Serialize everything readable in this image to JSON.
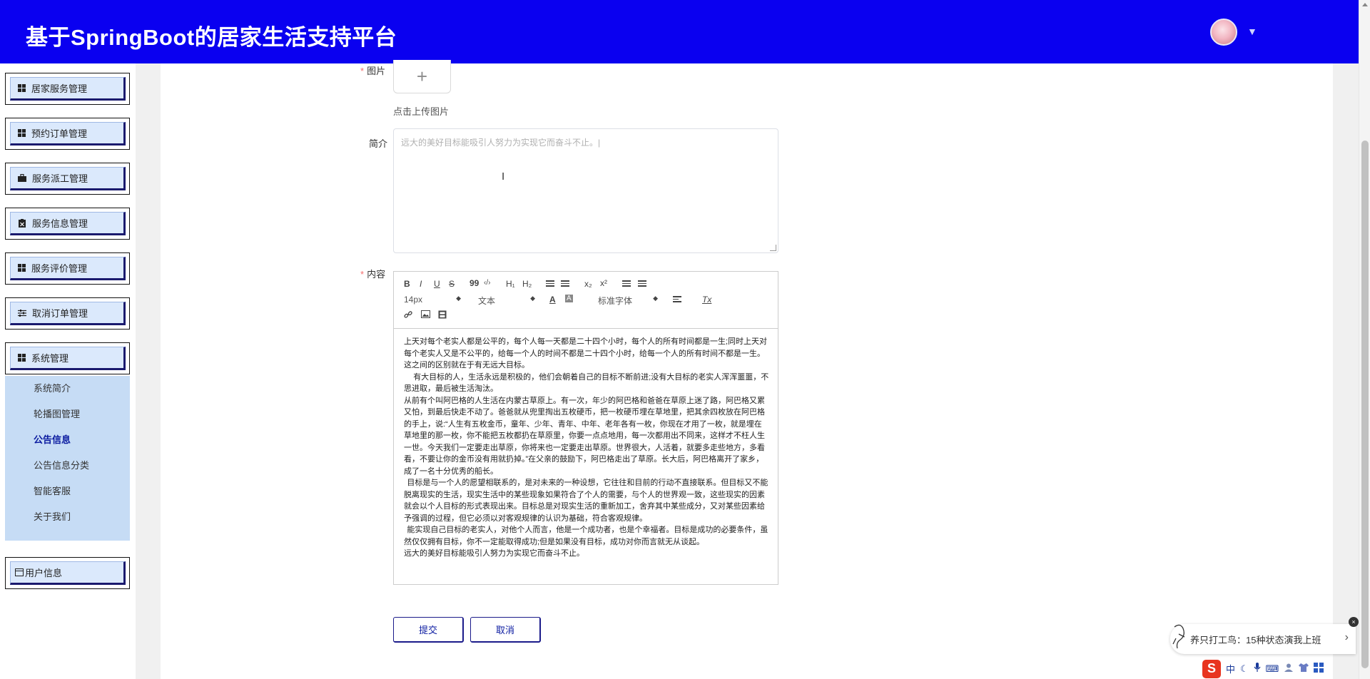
{
  "header": {
    "title": "基于SpringBoot的居家生活支持平台",
    "caret": "▼"
  },
  "sidebar": {
    "items": [
      {
        "label": "居家服务管理",
        "icon": "grid-icon"
      },
      {
        "label": "预约订单管理",
        "icon": "grid-icon"
      },
      {
        "label": "服务派工管理",
        "icon": "briefcase-icon"
      },
      {
        "label": "服务信息管理",
        "icon": "clipboard-icon"
      },
      {
        "label": "服务评价管理",
        "icon": "grid-icon"
      },
      {
        "label": "取消订单管理",
        "icon": "sliders-icon"
      },
      {
        "label": "系统管理",
        "icon": "grid-icon"
      }
    ],
    "submenu": [
      {
        "label": "系统简介"
      },
      {
        "label": "轮播图管理"
      },
      {
        "label": "公告信息",
        "active": true
      },
      {
        "label": "公告信息分类"
      },
      {
        "label": "智能客服"
      },
      {
        "label": "关于我们"
      }
    ],
    "user_info": "用户信息"
  },
  "form": {
    "image_label": "图片",
    "upload_plus": "+",
    "upload_tip": "点击上传图片",
    "intro_label": "简介",
    "intro_placeholder": "远大的美好目标能吸引人努力为实现它而奋斗不止。|",
    "content_label": "内容",
    "required_mark": "*",
    "toolbar": {
      "bold": "B",
      "italic": "I",
      "underline": "U",
      "strike": "S",
      "quote": "99",
      "code": "‹/›",
      "h1": "H₁",
      "h2": "H₂",
      "sub": "x₂",
      "sup": "x²",
      "size": "14px",
      "text_type": "文本",
      "font": "标准字体",
      "font_color": "A",
      "bg_color": "A",
      "clear": "Tx"
    },
    "content_paragraphs": [
      "上天对每个老实人都是公平的，每个人每一天都是二十四个小时，每个人的所有时间都是一生;同时上天对每个老实人又是不公平的，给每一个人的时间不都是二十四个小时，给每一个人的所有时间不都是一生。这之间的区别就在于有无远大目标。",
      "有大目标的人，生活永远是积极的，他们会朝着自己的目标不断前进;没有大目标的老实人浑浑噩噩，不思进取，最后被生活淘汰。",
      "从前有个叫阿巴格的人生活在内蒙古草原上。有一次，年少的阿巴格和爸爸在草原上迷了路，阿巴格又累又怕，到最后快走不动了。爸爸就从兜里掏出五枚硬币，把一枚硬币埋在草地里，把其余四枚放在阿巴格的手上，说:“人生有五枚金币，童年、少年、青年、中年、老年各有一枚，你现在才用了一枚，就是埋在草地里的那一枚，你不能把五枚都扔在草原里，你要一点点地用，每一次都用出不同来，这样才不枉人生一世。今天我们一定要走出草原，你将来也一定要走出草原。世界很大，人活着，就要多走些地方，多看看，不要让你的金币没有用就扔掉。”在父亲的鼓励下，阿巴格走出了草原。长大后，阿巴格离开了家乡，成了一名十分优秀的船长。",
      "目标是与一个人的愿望相联系的，是对未来的一种设想，它往往和目前的行动不直接联系。但目标又不能脱离现实的生活，现实生活中的某些现象如果符合了个人的需要，与个人的世界观一致，这些现实的因素就会以个人目标的形式表现出来。目标总是对现实生活的重新加工，舍弃其中某些成分，又对某些因素给予强调的过程，但它必须以对客观规律的认识为基础，符合客观规律。",
      "能实现自己目标的老实人，对他个人而言，他是一个成功者，也是个幸福者。目标是成功的必要条件，虽然仅仅拥有目标，你不一定能取得成功;但是如果没有目标，成功对你而言就无从谈起。",
      "远大的美好目标能吸引人努力为实现它而奋斗不止。"
    ],
    "submit": "提交",
    "cancel": "取消"
  },
  "notification": {
    "text": "养只打工鸟：15种状态演我上班",
    "chevron": "›",
    "close": "×"
  },
  "tray": {
    "logo": "S",
    "ime": "中",
    "moon": "☾",
    "mic": "🎤",
    "kbd": "⌨"
  }
}
